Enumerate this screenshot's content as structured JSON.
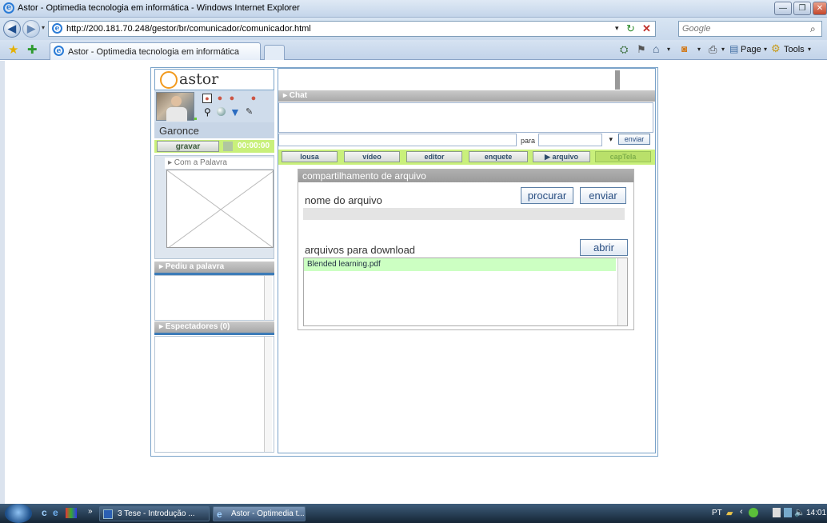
{
  "browser": {
    "window_title": "Astor - Optimedia tecnologia em informática - Windows Internet Explorer",
    "url": "http://200.181.70.248/gestor/br/comunicador/comunicador.html",
    "search_placeholder": "Google",
    "tab_title": "Astor - Optimedia tecnologia em informática",
    "toolbar": {
      "page_label": "Page",
      "tools_label": "Tools"
    }
  },
  "app": {
    "logo_text": "astor",
    "user_name": "Garonce",
    "record_button": "gravar",
    "timer": "00:00:00",
    "com_a_palavra": "▸ Com a Palavra",
    "pediu_a_palavra": "▸ Pediu a palavra",
    "espectadores": "▸ Espectadores  (0)",
    "chat": {
      "header": "▸ Chat",
      "para_label": "para",
      "send_button": "enviar"
    },
    "tabs": [
      {
        "label": "lousa"
      },
      {
        "label": "vídeo"
      },
      {
        "label": "editor"
      },
      {
        "label": "enquete"
      },
      {
        "label": "▶ arquivo"
      },
      {
        "label": "capTela"
      }
    ],
    "file_share": {
      "header": "compartilhamento de arquivo",
      "file_name_label": "nome do arquivo",
      "browse_button": "procurar",
      "send_button": "enviar",
      "downloads_label": "arquivos para download",
      "open_button": "abrir",
      "files": [
        "Blended learning.pdf"
      ]
    }
  },
  "taskbar": {
    "items": [
      {
        "label": "3 Tese - Introdução ..."
      },
      {
        "label": "Astor - Optimedia t..."
      }
    ],
    "lang": "PT",
    "clock": "14:01"
  }
}
